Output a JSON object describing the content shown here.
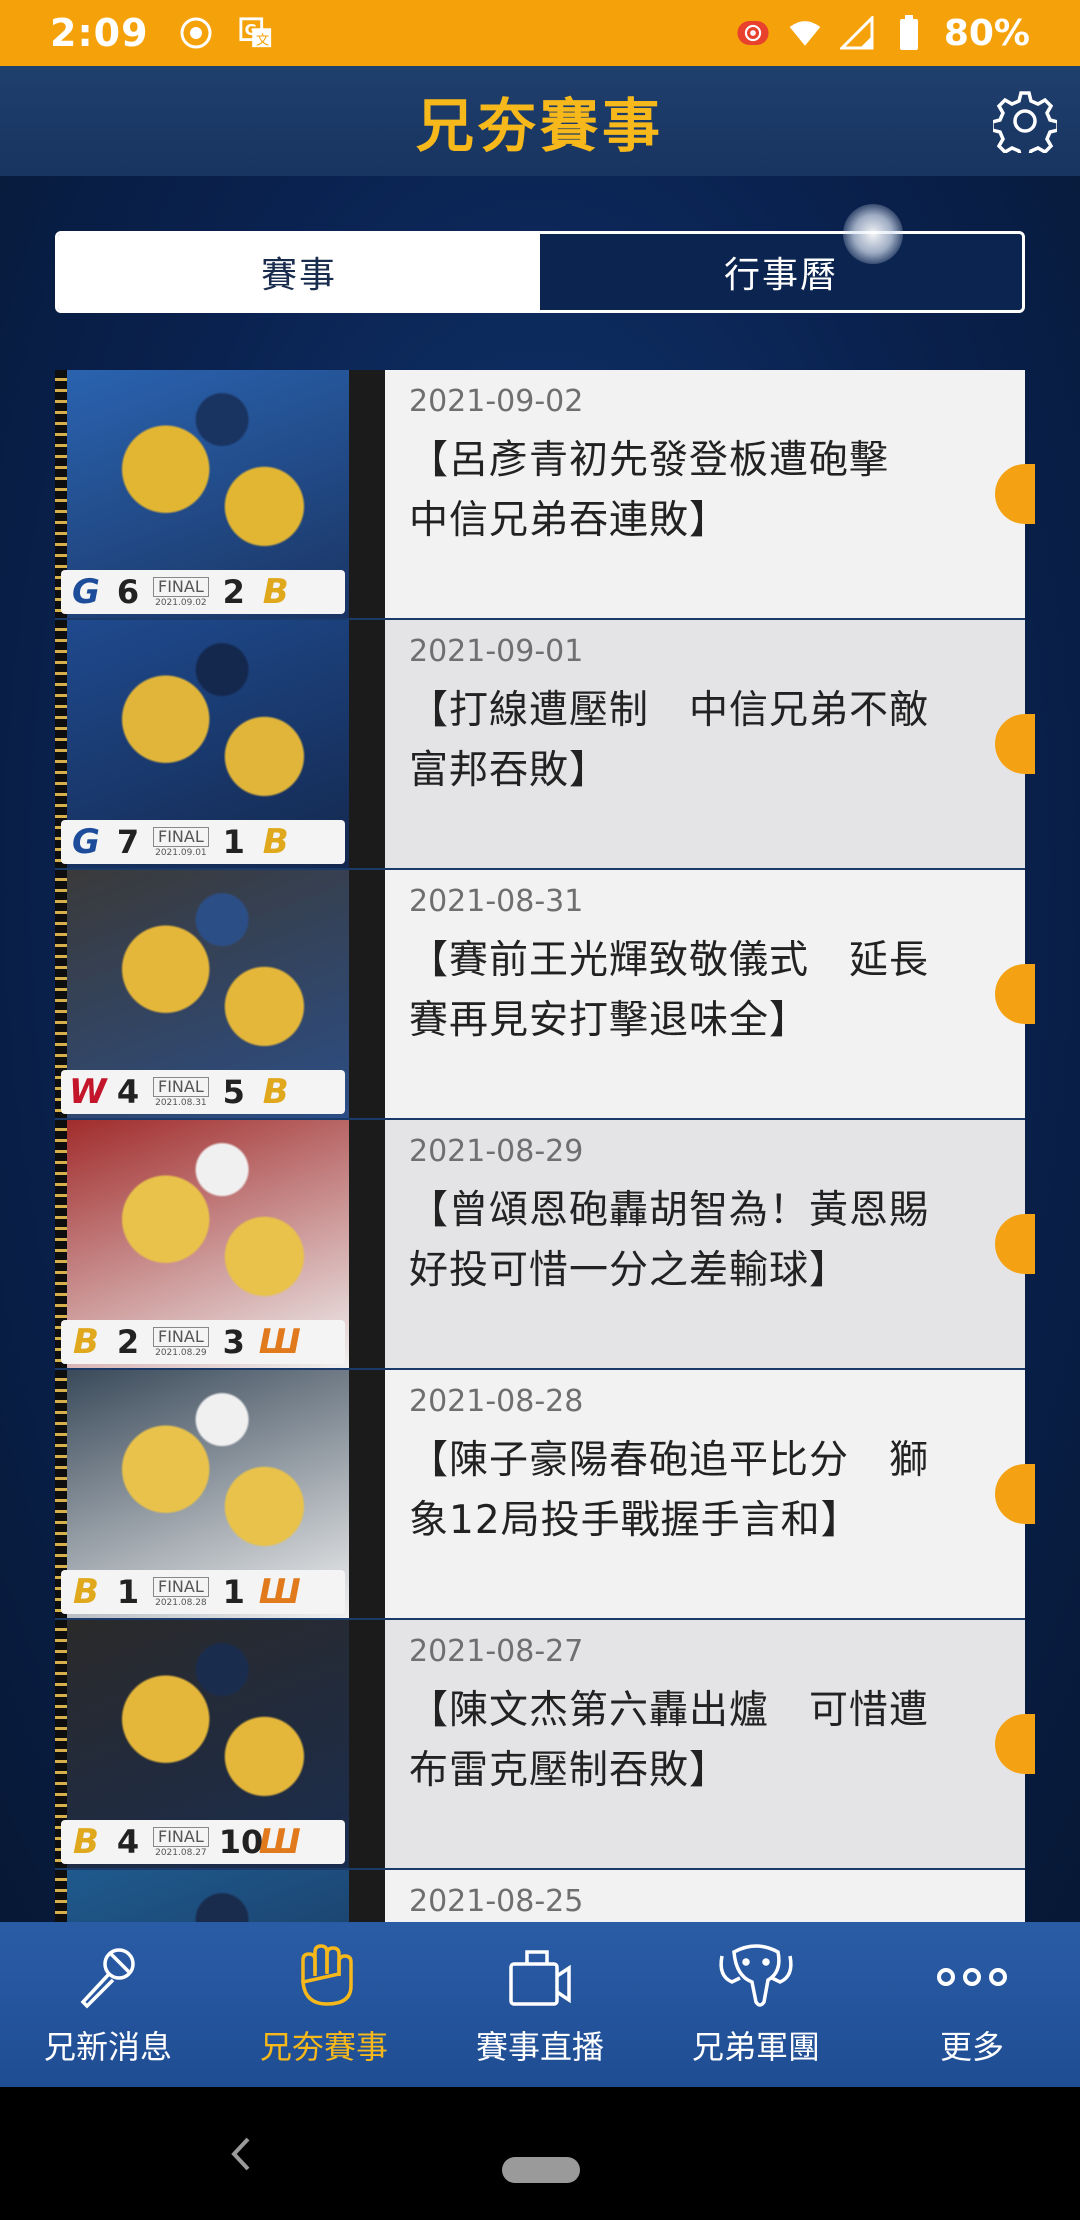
{
  "status_bar": {
    "time": "2:09",
    "battery": "80%",
    "icons": [
      "record-icon",
      "translate-icon",
      "screen-record-icon",
      "wifi-icon",
      "signal-icon",
      "battery-icon"
    ]
  },
  "header": {
    "title": "兄夯賽事",
    "settings_icon": "gear-icon"
  },
  "tabs": [
    {
      "label": "賽事",
      "active": true
    },
    {
      "label": "行事曆",
      "active": false
    }
  ],
  "games": [
    {
      "date": "2021-09-02",
      "title": "【呂彥青初先發登板遭砲擊\n中信兄弟吞連敗】",
      "home_logo": "G",
      "home_score": "6",
      "away_score": "2",
      "away_logo": "B",
      "final": "FINAL",
      "final_date": "2021.09.02",
      "home_color": "#1d4d9a",
      "away_color": "#e0a81c"
    },
    {
      "date": "2021-09-01",
      "title": "【打線遭壓制　中信兄弟不敵\n富邦吞敗】",
      "home_logo": "G",
      "home_score": "7",
      "away_score": "1",
      "away_logo": "B",
      "final": "FINAL",
      "final_date": "2021.09.01",
      "home_color": "#1d4d9a",
      "away_color": "#e0a81c"
    },
    {
      "date": "2021-08-31",
      "title": "【賽前王光輝致敬儀式　延長\n賽再見安打擊退味全】",
      "home_logo": "W",
      "home_score": "4",
      "away_score": "5",
      "away_logo": "B",
      "final": "FINAL",
      "final_date": "2021.08.31",
      "home_color": "#c4162a",
      "away_color": "#e0a81c"
    },
    {
      "date": "2021-08-29",
      "title": "【曾頌恩砲轟胡智為！黃恩賜\n好投可惜一分之差輸球】",
      "home_logo": "B",
      "home_score": "2",
      "away_score": "3",
      "away_logo": "Ш",
      "final": "FINAL",
      "final_date": "2021.08.29",
      "home_color": "#e0a81c",
      "away_color": "#e07a1c"
    },
    {
      "date": "2021-08-28",
      "title": "【陳子豪陽春砲追平比分　獅\n象12局投手戰握手言和】",
      "home_logo": "B",
      "home_score": "1",
      "away_score": "1",
      "away_logo": "Ш",
      "final": "FINAL",
      "final_date": "2021.08.28",
      "home_color": "#e0a81c",
      "away_color": "#e07a1c"
    },
    {
      "date": "2021-08-27",
      "title": "【陳文杰第六轟出爐　可惜遭\n布雷克壓制吞敗】",
      "home_logo": "B",
      "home_score": "4",
      "away_score": "10",
      "away_logo": "Ш",
      "final": "FINAL",
      "final_date": "2021.08.27",
      "home_color": "#e0a81c",
      "away_color": "#e07a1c"
    },
    {
      "date": "2021-08-25",
      "title": "",
      "home_logo": "",
      "home_score": "",
      "away_score": "",
      "away_logo": "",
      "final": "",
      "final_date": "",
      "home_color": "#e0a81c",
      "away_color": "#e0a81c"
    }
  ],
  "bottom_nav": [
    {
      "label": "兄新消息",
      "icon": "microphone-icon",
      "active": false
    },
    {
      "label": "兄夯賽事",
      "icon": "baseball-glove-icon",
      "active": true
    },
    {
      "label": "賽事直播",
      "icon": "tv-icon",
      "active": false
    },
    {
      "label": "兄弟軍團",
      "icon": "elephant-icon",
      "active": false
    },
    {
      "label": "更多",
      "icon": "more-dots-icon",
      "active": false
    }
  ],
  "colors": {
    "status_bar": "#f5a20a",
    "accent": "#f6b81a",
    "header": "#1f3f6d",
    "nav": "#2a5ca6"
  }
}
